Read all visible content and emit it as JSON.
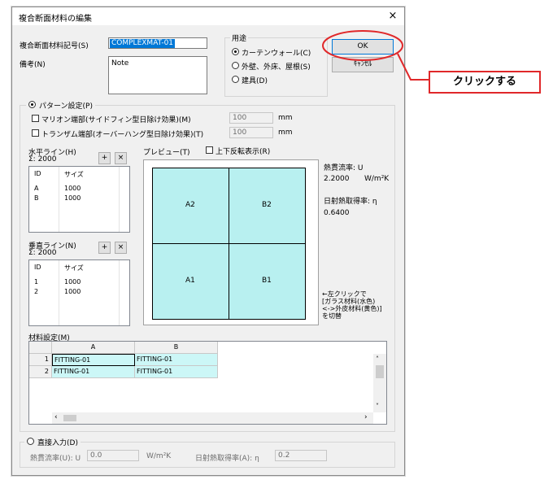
{
  "dialog": {
    "title": "複合断面材料の編集",
    "close_glyph": "×",
    "material_code_label": "複合断面材料記号(S)",
    "material_code_value": "COMPLEXMAT-01",
    "remarks_label": "備考(N)",
    "remarks_value": "Note",
    "usage": {
      "label": "用途",
      "options": [
        "カーテンウォール(C)",
        "外壁、外床、屋根(S)",
        "建具(D)"
      ],
      "selected_index": 0
    },
    "ok_label": "OK",
    "cancel_label": "ｷｬﾝｾﾙ",
    "pattern": {
      "label": "パターン設定(P)",
      "mullion_label": "マリオン端部(サイドフィン型日除け効果)(M)",
      "mullion_value": "100",
      "mullion_unit": "mm",
      "transom_label": "トランザム端部(オーバーハング型日除け効果)(T)",
      "transom_value": "100",
      "transom_unit": "mm"
    },
    "horizontal": {
      "label": "水平ライン(H)",
      "sum": "Σ: 2000",
      "add": "+",
      "remove": "×",
      "col_id": "ID",
      "col_size": "サイズ",
      "rows": [
        {
          "id": "A",
          "size": "1000"
        },
        {
          "id": "B",
          "size": "1000"
        }
      ]
    },
    "vertical": {
      "label": "垂直ライン(N)",
      "sum": "Σ: 2000",
      "add": "+",
      "remove": "×",
      "col_id": "ID",
      "col_size": "サイズ",
      "rows": [
        {
          "id": "1",
          "size": "1000"
        },
        {
          "id": "2",
          "size": "1000"
        }
      ]
    },
    "preview": {
      "label": "プレビュー(T)",
      "flip_label": "上下反転表示(R)",
      "cells": [
        "A2",
        "B2",
        "A1",
        "B1"
      ],
      "cell_color": "#b8f0f0"
    },
    "thermal": {
      "u_label": "熱貫流率: U",
      "u_value": "2.2000",
      "u_unit": "W/m²K",
      "eta_label": "日射熱取得率: η",
      "eta_value": "0.6400"
    },
    "hint": [
      "←左クリックで",
      "[ガラス材料(水色)",
      "<->外皮材料(黄色)]",
      "を切替"
    ],
    "material_settings": {
      "label": "材料設定(M)",
      "columns": [
        "A",
        "B"
      ],
      "rows": [
        {
          "num": "1",
          "a": "FITTING-01",
          "b": "FITTING-01"
        },
        {
          "num": "2",
          "a": "FITTING-01",
          "b": "FITTING-01"
        }
      ]
    },
    "direct": {
      "label": "直接入力(D)",
      "u_label": "熱貫流率(U): U",
      "u_value": "0.0",
      "u_unit": "W/m²K",
      "eta_label": "日射熱取得率(A): η",
      "eta_value": "0.2"
    }
  },
  "callout": {
    "text": "クリックする",
    "color": "#e0282a"
  }
}
